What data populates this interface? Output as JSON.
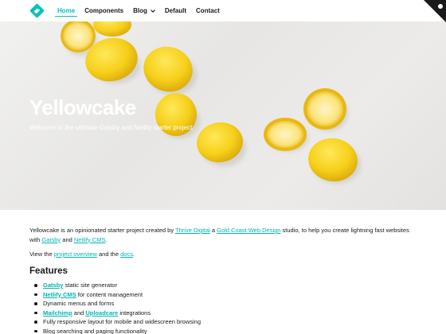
{
  "header": {
    "nav": [
      {
        "label": "Home"
      },
      {
        "label": "Components"
      },
      {
        "label": "Blog"
      },
      {
        "label": "Default"
      },
      {
        "label": "Contact"
      }
    ]
  },
  "hero": {
    "title": "Yellowcake",
    "subtitle": "Welcome to the ultimate Gatsby and Netlify starter project."
  },
  "intro": {
    "text1": "Yellowcake is an opinionated starter project created by ",
    "link1": "Thrive Digital",
    "text2": " a ",
    "link2": "Gold Coast Web Design",
    "text3": " studio, to help you create lightning fast websites with ",
    "link3": "Gatsby",
    "text4": " and ",
    "link4": "Netlify CMS",
    "text5": "."
  },
  "view": {
    "text1": "View the ",
    "link1": "project overview",
    "text2": " and the ",
    "link2": "docs",
    "text3": "."
  },
  "features": {
    "heading": "Features",
    "items": [
      {
        "link": "Gatsby",
        "text": " static site generator"
      },
      {
        "link": "Netlify CMS",
        "text": " for content management"
      },
      {
        "text": "Dynamic menus and forms"
      },
      {
        "link": "Mailchimp",
        "mid": " and ",
        "link2": "Uploadcare",
        "text": " integrations"
      },
      {
        "text": "Fully responsive layout for mobile and widescreen browsing"
      },
      {
        "text": "Blog searching and paging functionality"
      }
    ]
  },
  "colors": {
    "accent": "#00c2bd",
    "lemon": "#f6d01a",
    "text": "#1a1a1a"
  }
}
